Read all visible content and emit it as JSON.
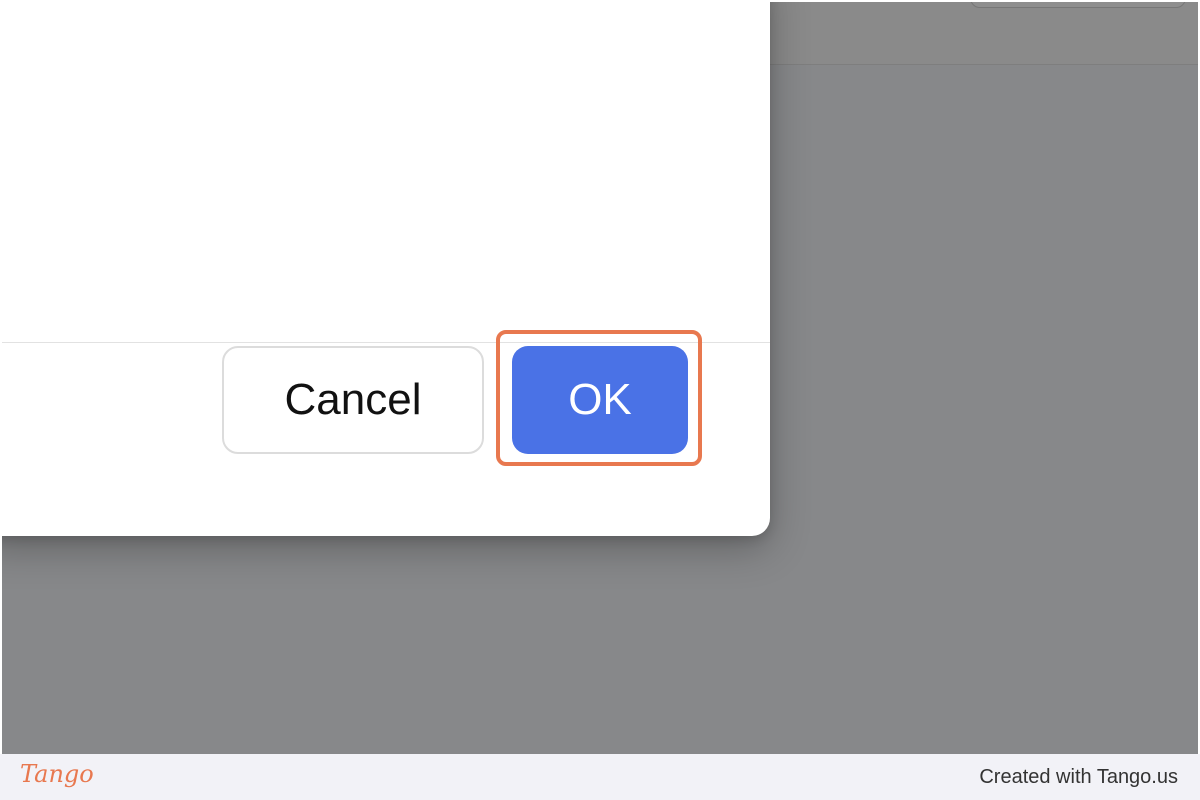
{
  "dialog": {
    "cancel_label": "Cancel",
    "ok_label": "OK"
  },
  "footer": {
    "logo_text": "Tango",
    "credit": "Created with Tango.us"
  },
  "colors": {
    "overlay_background": "#87888a",
    "dialog_background": "#ffffff",
    "ok_button": "#4a72e6",
    "highlight": "#e8784f",
    "footer_background": "#f2f2f7"
  },
  "icons": {
    "logo": "tango-logo"
  }
}
